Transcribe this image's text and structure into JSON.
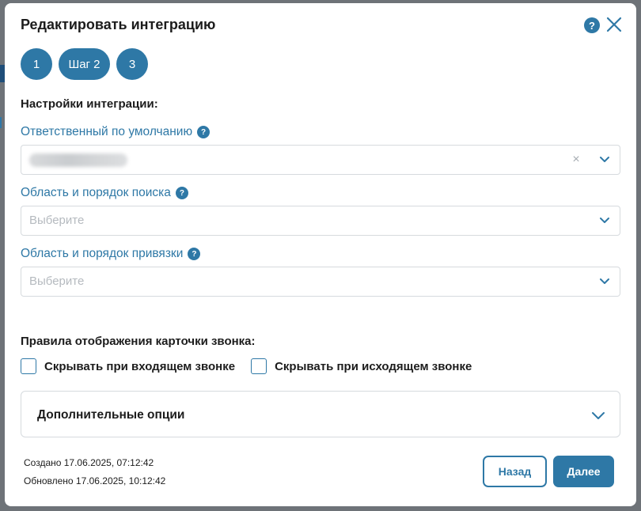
{
  "modal": {
    "title": "Редактировать интеграцию",
    "help_icon": "?",
    "close_icon": "close-icon"
  },
  "steps": [
    "1",
    "Шаг 2",
    "3"
  ],
  "integration_settings": {
    "title": "Настройки интеграции:",
    "fields": [
      {
        "label": "Ответственный по умолчанию",
        "help": "?",
        "value": "",
        "placeholder": ""
      },
      {
        "label": "Область и порядок поиска",
        "help": "?",
        "placeholder": "Выберите"
      },
      {
        "label": "Область и порядок привязки",
        "help": "?",
        "placeholder": "Выберите"
      }
    ],
    "clear_symbol": "×"
  },
  "call_card": {
    "title": "Правила отображения карточки звонка:",
    "options": [
      {
        "label": "Скрывать при входящем звонке",
        "checked": false
      },
      {
        "label": "Скрывать при исходящем звонке",
        "checked": false
      }
    ]
  },
  "extra": {
    "title": "Дополнительные опции"
  },
  "meta": {
    "created": "Создано 17.06.2025, 07:12:42",
    "updated": "Обновлено 17.06.2025, 10:12:42"
  },
  "buttons": {
    "back": "Назад",
    "next": "Далее"
  },
  "colors": {
    "accent": "#2e78a6",
    "backdrop": "#6e7378",
    "border": "#d6dade"
  }
}
